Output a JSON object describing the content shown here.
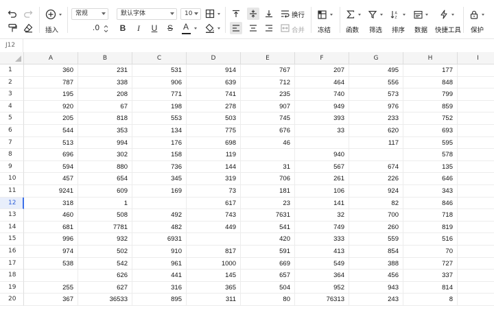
{
  "toolbar": {
    "insert_label": "插入",
    "number_format": "常规",
    "font_name": "默认字体",
    "font_size": "10",
    "decimal_text": ".0",
    "wrap_label": "换行",
    "merge_label": "合并",
    "freeze_label": "冻结",
    "function_label": "函数",
    "filter_label": "筛选",
    "sort_label": "排序",
    "data_label": "数据",
    "quick_tools_label": "快捷工具",
    "protect_label": "保护",
    "bold_glyph": "B",
    "italic_glyph": "I",
    "underline_glyph": "U",
    "strike_glyph": "S",
    "fontcolor_glyph": "A",
    "accent_red": "#e53935"
  },
  "namebox": "J12",
  "columns": [
    "A",
    "B",
    "C",
    "D",
    "E",
    "F",
    "G",
    "H",
    "I"
  ],
  "selected_row": "12",
  "rows": [
    {
      "n": "1",
      "c": [
        "360",
        "231",
        "531",
        "914",
        "767",
        "207",
        "495",
        "177",
        ""
      ]
    },
    {
      "n": "2",
      "c": [
        "787",
        "338",
        "906",
        "639",
        "712",
        "464",
        "556",
        "848",
        ""
      ]
    },
    {
      "n": "3",
      "c": [
        "195",
        "208",
        "771",
        "741",
        "235",
        "740",
        "573",
        "799",
        ""
      ]
    },
    {
      "n": "4",
      "c": [
        "920",
        "67",
        "198",
        "278",
        "907",
        "949",
        "976",
        "859",
        ""
      ]
    },
    {
      "n": "5",
      "c": [
        "205",
        "818",
        "553",
        "503",
        "745",
        "393",
        "233",
        "752",
        ""
      ]
    },
    {
      "n": "6",
      "c": [
        "544",
        "353",
        "134",
        "775",
        "676",
        "33",
        "620",
        "693",
        ""
      ]
    },
    {
      "n": "7",
      "c": [
        "513",
        "994",
        "176",
        "698",
        "46",
        "",
        "117",
        "595",
        ""
      ]
    },
    {
      "n": "8",
      "c": [
        "696",
        "302",
        "158",
        "119",
        "",
        "940",
        "",
        "578",
        ""
      ]
    },
    {
      "n": "9",
      "c": [
        "594",
        "880",
        "736",
        "144",
        "31",
        "567",
        "674",
        "135",
        ""
      ]
    },
    {
      "n": "10",
      "c": [
        "457",
        "654",
        "345",
        "319",
        "706",
        "261",
        "226",
        "646",
        ""
      ]
    },
    {
      "n": "11",
      "c": [
        "9241",
        "609",
        "169",
        "73",
        "181",
        "106",
        "924",
        "343",
        ""
      ]
    },
    {
      "n": "12",
      "c": [
        "318",
        "1",
        "",
        "617",
        "23",
        "141",
        "82",
        "846",
        ""
      ]
    },
    {
      "n": "13",
      "c": [
        "460",
        "508",
        "492",
        "743",
        "7631",
        "32",
        "700",
        "718",
        ""
      ]
    },
    {
      "n": "14",
      "c": [
        "681",
        "7781",
        "482",
        "449",
        "541",
        "749",
        "260",
        "819",
        ""
      ]
    },
    {
      "n": "15",
      "c": [
        "996",
        "932",
        "6931",
        "",
        "420",
        "333",
        "559",
        "516",
        ""
      ]
    },
    {
      "n": "16",
      "c": [
        "974",
        "502",
        "910",
        "817",
        "591",
        "413",
        "854",
        "70",
        ""
      ]
    },
    {
      "n": "17",
      "c": [
        "538",
        "542",
        "961",
        "1000",
        "669",
        "549",
        "388",
        "727",
        ""
      ]
    },
    {
      "n": "18",
      "c": [
        "",
        "626",
        "441",
        "145",
        "657",
        "364",
        "456",
        "337",
        ""
      ]
    },
    {
      "n": "19",
      "c": [
        "255",
        "627",
        "316",
        "365",
        "504",
        "952",
        "943",
        "814",
        ""
      ]
    },
    {
      "n": "20",
      "c": [
        "367",
        "36533",
        "895",
        "311",
        "80",
        "76313",
        "243",
        "8",
        ""
      ]
    }
  ]
}
